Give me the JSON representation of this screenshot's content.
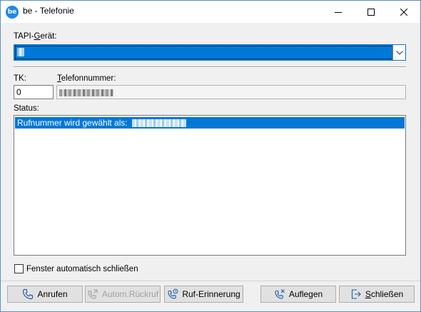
{
  "window": {
    "logo_text": "be",
    "title": "be - Telefonie"
  },
  "tapi": {
    "label_prefix": "TAPI-",
    "label_accesskey": "G",
    "label_suffix": "erät:",
    "selected_value_redacted": true
  },
  "tk": {
    "label": "TK:",
    "value": "0"
  },
  "telefon": {
    "label_accesskey": "T",
    "label_suffix": "elefonnummer:",
    "value_redacted": true
  },
  "status": {
    "label": "Status:",
    "message": "Rufnummer wird gewählt als:",
    "number_redacted": true
  },
  "auto_close": {
    "label": "Fenster automatisch schließen",
    "checked": false
  },
  "buttons": {
    "anrufen": "Anrufen",
    "rueckruf": "Autom.Rückruf",
    "erinnerung": "Ruf-Erinnerung",
    "auflegen": "Auflegen",
    "schliessen_accesskey": "S",
    "schliessen_suffix": "chließen"
  },
  "colors": {
    "selection": "#0078d7",
    "icon": "#1e5fa8",
    "disabled_text": "#a0a0a0"
  },
  "icons": [
    "app-logo",
    "minimize-icon",
    "maximize-icon",
    "close-icon",
    "chevron-down-icon",
    "phone-icon",
    "phone-redial-icon",
    "phone-reminder-icon",
    "phone-hangup-icon",
    "exit-icon"
  ]
}
